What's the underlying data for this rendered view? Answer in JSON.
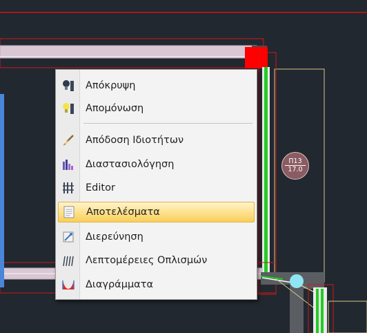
{
  "context_menu": {
    "items": [
      {
        "label": "Απόκρυψη",
        "icon": "hide-bulb-icon"
      },
      {
        "label": "Απομόνωση",
        "icon": "isolate-bulb-icon"
      },
      {
        "label": "Απόδοση Ιδιοτήτων",
        "icon": "brush-icon"
      },
      {
        "label": "Διαστασιολόγηση",
        "icon": "dimensioning-icon"
      },
      {
        "label": "Editor",
        "icon": "editor-icon"
      },
      {
        "label": "Αποτελέσματα",
        "icon": "results-icon",
        "highlighted": true
      },
      {
        "label": "Διερεύνηση",
        "icon": "investigate-icon"
      },
      {
        "label": "Λεπτομέρειες Οπλισμών",
        "icon": "rebar-details-icon"
      },
      {
        "label": "Διαγράμματα",
        "icon": "diagrams-icon"
      }
    ]
  },
  "column_tag": {
    "name": "Π13",
    "value": "17.0"
  },
  "colors": {
    "background": "#212830",
    "beam_fill": "#d9c7d4",
    "red_outline": "#d01818",
    "green_rebar": "#22cc22",
    "yellow_outline": "#d7c98a",
    "menu_highlight": "#fde08a"
  }
}
